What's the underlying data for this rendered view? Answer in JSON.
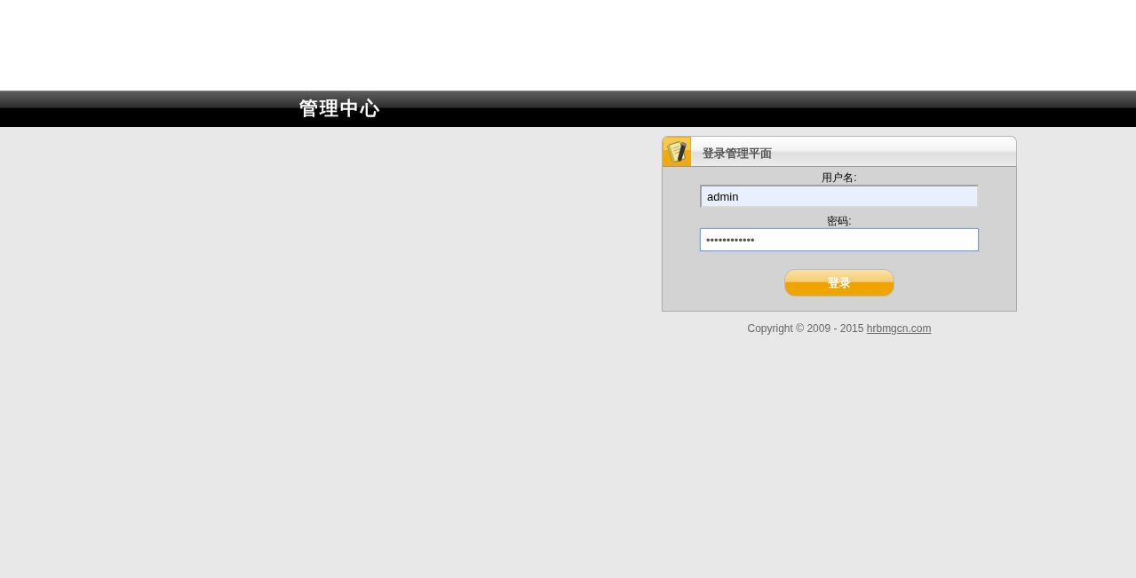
{
  "header": {
    "title": "管理中心"
  },
  "login_panel": {
    "title": "登录管理平面",
    "fields": [
      {
        "label": "用户名:",
        "value": "admin",
        "focused": false
      },
      {
        "label": "密码:",
        "value": "••••••••••••",
        "focused": true
      }
    ],
    "submit_button": "登录"
  },
  "footer": {
    "copyright": "Copyright © 2009 - 2015",
    "link": "hrbmgcn.com"
  }
}
